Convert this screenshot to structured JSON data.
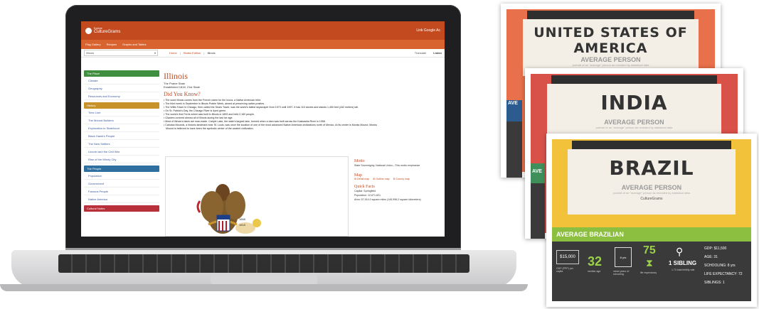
{
  "site": {
    "brand_small": "Explore",
    "brand_name": "CultureGrams",
    "top_right_link": "Link Google Ac"
  },
  "nav": {
    "items": [
      "Flag Gallery",
      "Recipes",
      "Graphs and Tables"
    ]
  },
  "location_bar": {
    "state_select_value": "Illinois",
    "breadcrumbs": [
      "Home",
      "States Edition",
      "Illinois"
    ],
    "translate_label": "Translate",
    "listen_label": "Listen"
  },
  "sidebar": {
    "sections": [
      {
        "title": "The Place",
        "color": "#3f8f3f",
        "items": [
          "Climate",
          "Geography",
          "Resources and Economy"
        ]
      },
      {
        "title": "History",
        "color": "#c8922a",
        "items": [
          "Time Line",
          "The Mound Builders",
          "Exploration to Statehood",
          "Black Hawk's People",
          "The New Settlers",
          "Lincoln and the Civil War",
          "Rise of the Windy City"
        ]
      },
      {
        "title": "The People",
        "color": "#2e6fa0",
        "items": [
          "Population",
          "Government",
          "Famous People",
          "Native America"
        ]
      },
      {
        "title": "Cultural Notes",
        "color": "#b8303a",
        "items": []
      }
    ]
  },
  "article": {
    "title": "Illinois",
    "nickname": "The Prairie State",
    "established": "Established 1818, 21st State",
    "did_you_know_heading": "Did You Know?",
    "facts": [
      "The word Illinois comes from the French name for the Inoca, a Native American tribe.",
      "The third week in September is Illinois Prairie Week, aimed at preserving native prairies.",
      "The Willis Tower in Chicago, then called the Sears Tower, was the world's tallest skyscraper from 1973 until 1997. It has 110 stories and stands 1,450 feet (442 meters) tall.",
      "On St. Patrick's Day, the Chicago River is dyed green.",
      "The world's first Ferris wheel was built in Illinois in 1893 and held 2,160 people.",
      "Glaciers covered almost all of Illinois during the last ice age.",
      "Most of Illinois's lakes are man-made. Carlyle Lake, the state's largest lake, formed when a dam was built across the Kaskaskia River in 1958.",
      "Cahokia Mounds, a historic landmark near St. Louis, was once the location of one of the most advanced Native American civilizations north of Mexico. At its center is Monks Mound. Monks",
      "Mound is believed to have been the symbolic center of the ancient civilization."
    ],
    "seal_dates": [
      "1868",
      "1818"
    ]
  },
  "right_column": {
    "motto_heading": "Motto",
    "motto_text": "State Sovereignty, National Union—This motto emphasize",
    "map_heading": "Map",
    "map_links": [
      "Detail map",
      "Outline map",
      "County map"
    ],
    "quick_facts_heading": "Quick Facts",
    "capital": "Capital: Springfield",
    "population": "Population: 12,671,821",
    "area": "Area: 57,914.0 square miles (149,998.2 square kilometers)"
  },
  "cards": [
    {
      "title_line1": "UNITED STATES OF",
      "title_line2": "AMERICA",
      "subtitle": "AVERAGE PERSON",
      "tiny": "portrait of an \"average\" person as revealed by statistical data",
      "color": "#e8704a"
    },
    {
      "title_line1": "INDIA",
      "title_line2": "",
      "subtitle": "AVERAGE PERSON",
      "tiny": "portrait of an \"average\" person as revealed by statistical data",
      "color": "#d9524a"
    },
    {
      "title_line1": "BRAZIL",
      "title_line2": "",
      "subtitle": "AVERAGE PERSON",
      "tiny": "portrait of an \"average\" person as revealed by statistical data",
      "color": "#f2c23a"
    }
  ],
  "brazil_card": {
    "brand": "CultureGrams",
    "panel_heading": "AVERAGE BRAZILIAN",
    "gdp_box": "$15,000",
    "gdp_caption": "GDP (PPP) per capita",
    "median_age": "32",
    "median_caption": "median age",
    "school_years": "8 yrs",
    "school_caption": "mean years of schooling",
    "life_exp": "75",
    "life_caption": "life expectancy",
    "siblings": "1 SIBLING",
    "siblings_caption": "1.73 total fertility rate",
    "stats": [
      "GDP: $11,500",
      "AGE: 31",
      "SCHOOLING: 8 yrs",
      "LIFE EXPECTANCY: 72",
      "SIBLINGS: 1"
    ],
    "side_label_usa": "AVE",
    "side_label_india": "AVE"
  }
}
